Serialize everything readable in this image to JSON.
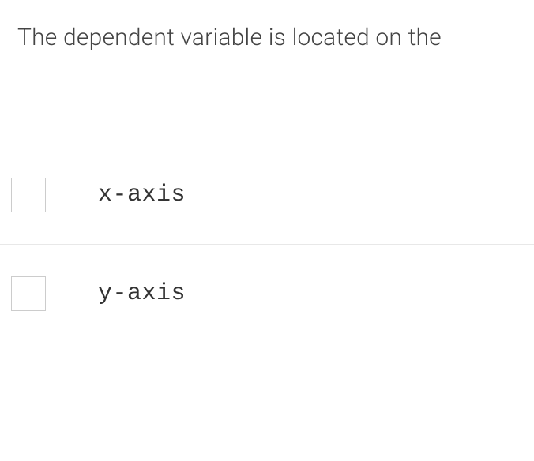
{
  "question": {
    "text": "The dependent variable is located on the"
  },
  "options": [
    {
      "label": "x-axis"
    },
    {
      "label": "y-axis"
    }
  ]
}
